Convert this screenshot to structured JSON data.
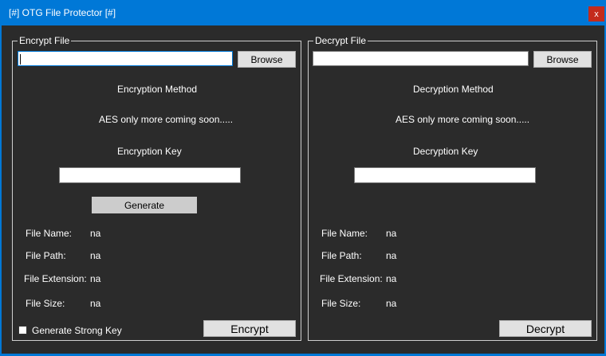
{
  "window": {
    "title": "[#] OTG File Protector [#]",
    "close_glyph": "x"
  },
  "encrypt": {
    "group_title": "Encrypt File",
    "file_value": "",
    "browse_label": "Browse",
    "method_label": "Encryption Method",
    "method_note": "AES only more coming soon.....",
    "key_label": "Encryption Key",
    "key_value": "",
    "generate_label": "Generate",
    "info": [
      {
        "label": "File Name:",
        "value": "na"
      },
      {
        "label": "File Path:",
        "value": "na"
      },
      {
        "label": "File Extension:",
        "value": "na"
      },
      {
        "label": "File Size:",
        "value": "na"
      }
    ],
    "strong_key_label": "Generate Strong Key",
    "strong_key_checked": false,
    "action_label": "Encrypt"
  },
  "decrypt": {
    "group_title": "Decrypt File",
    "file_value": "",
    "browse_label": "Browse",
    "method_label": "Decryption Method",
    "method_note": "AES only more coming soon.....",
    "key_label": "Decryption Key",
    "key_value": "",
    "info": [
      {
        "label": "File Name:",
        "value": "na"
      },
      {
        "label": "File Path:",
        "value": "na"
      },
      {
        "label": "File Extension:",
        "value": "na"
      },
      {
        "label": "File Size:",
        "value": "na"
      }
    ],
    "action_label": "Decrypt"
  },
  "colors": {
    "title_bar": "#0078d7",
    "close_button": "#c42b1c",
    "background": "#2b2b2b",
    "focus_border": "#0078d7"
  }
}
